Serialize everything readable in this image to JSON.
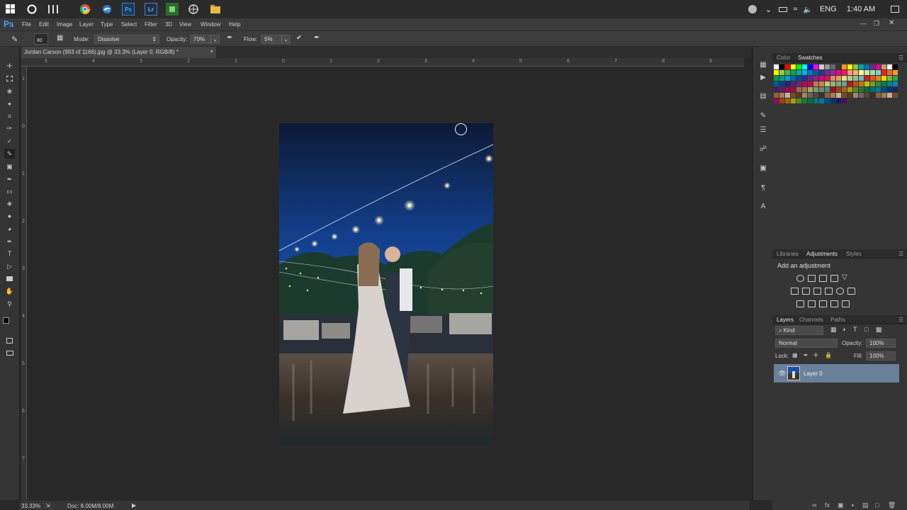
{
  "app": {
    "logo": "Ps"
  },
  "taskbar": {
    "pinned": [
      "windows-start",
      "cortana",
      "task-view",
      "chrome",
      "edge",
      "photoshop",
      "lightroom",
      "green-app",
      "globe-app",
      "file-explorer"
    ],
    "tray": {
      "lang": "ENG",
      "time": "1:40 AM"
    }
  },
  "menu": [
    "File",
    "Edit",
    "Image",
    "Layer",
    "Type",
    "Select",
    "Filter",
    "3D",
    "View",
    "Window",
    "Help"
  ],
  "options": {
    "brush_size": "80",
    "mode_label": "Mode:",
    "mode_value": "Dissolve",
    "opacity_label": "Opacity:",
    "opacity_value": "70%",
    "flow_label": "Flow:",
    "flow_value": "5%"
  },
  "document": {
    "tab_title": "Jordan Carson (993 of 1166).jpg @ 33.3% (Layer 0, RGB/8) *",
    "close": "×"
  },
  "rulers": {
    "h": [
      "5",
      "4",
      "3",
      "2",
      "1",
      "0",
      "1",
      "2",
      "3",
      "4",
      "5",
      "6",
      "7",
      "8",
      "9"
    ],
    "v": [
      "1",
      "0",
      "1",
      "2",
      "3",
      "4",
      "5",
      "6",
      "7"
    ]
  },
  "swatches_panel": {
    "tabs": [
      "Color",
      "Swatches"
    ],
    "active": "Swatches"
  },
  "adjustments_panel": {
    "tabs": [
      "Libraries",
      "Adjustments",
      "Styles"
    ],
    "active": "Adjustments",
    "heading": "Add an adjustment"
  },
  "layers_panel": {
    "tabs": [
      "Layers",
      "Channels",
      "Paths"
    ],
    "active": "Layers",
    "filter": "Kind",
    "blend_mode": "Normal",
    "opacity_label": "Opacity:",
    "opacity_value": "100%",
    "lock_label": "Lock:",
    "fill_label": "Fill:",
    "fill_value": "100%",
    "layers": [
      {
        "name": "Layer 0",
        "visible": true,
        "selected": true
      }
    ]
  },
  "status": {
    "zoom": "33.33%",
    "doc": "Doc: 8.00M/8.00M"
  },
  "colors": {
    "selection": "#6a7f9a",
    "ps_blue": "#4aa3ff"
  }
}
